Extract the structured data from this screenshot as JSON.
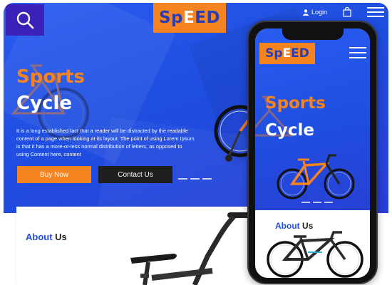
{
  "brand": {
    "logo_parts": [
      "S",
      "p",
      "E",
      "E",
      "D"
    ],
    "orange": "#f5831f",
    "blue": "#1f4ee0",
    "dark": "#1e1e1e"
  },
  "desktop": {
    "header": {
      "search_icon": "search-icon",
      "login_label": "Login",
      "user_icon": "user-icon",
      "bag_icon": "shopping-bag-icon",
      "menu_icon": "hamburger-menu-icon"
    },
    "hero": {
      "title_line1": "Sports",
      "title_line2": "Cycle",
      "paragraph_lines": [
        "It is a long established fact that a reader will be distracted by the readable",
        "content of a page when looking at its layout. The point of using Lorem Ipsum",
        "is that it has a more-or-less normal distribution of letters, as opposed to",
        "using Content here, content"
      ],
      "buy_label": "Buy Now",
      "contact_label": "Contact Us"
    },
    "about": {
      "title_accent": "About",
      "title_rest": " Us"
    }
  },
  "mobile": {
    "hero": {
      "title_line1": "Sports",
      "title_line2": "Cycle"
    },
    "about": {
      "title_accent": "About",
      "title_rest": " Us"
    }
  }
}
